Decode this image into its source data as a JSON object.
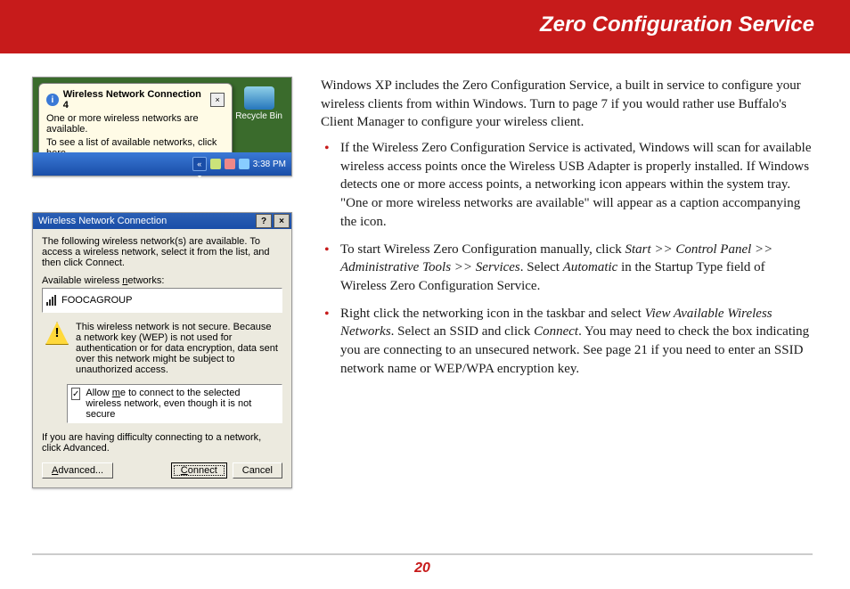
{
  "header": {
    "title": "Zero Configuration Service"
  },
  "footer": {
    "page_number": "20"
  },
  "intro": "Windows XP includes the Zero Configuration Service, a built in service to configure your wireless clients from within Windows.  Turn to page 7 if you would rather use Buffalo's Client Manager to configure your wireless client.",
  "bullets": {
    "b1": "If the Wireless Zero Configuration Service is activated, Windows will scan for available wireless access points once the Wireless USB Adapter is properly installed.  If Windows detects one or more access points, a networking icon appears within the system tray.  \"One or more wireless networks are available\" will appear as a caption accompanying the icon.",
    "b2_a": "To start Wireless Zero Configuration manually, click ",
    "b2_path": "Start >> Control Panel >> Administrative Tools >> Services",
    "b2_b": ". Select ",
    "b2_auto": "Automatic",
    "b2_c": " in the Startup Type field of Wireless Zero Configuration Service.",
    "b3_a": "Right click the networking icon in the taskbar and select ",
    "b3_view": "View Available Wireless Networks",
    "b3_b": ".  Select an SSID and click ",
    "b3_connect": "Connect",
    "b3_c": ".  You may need to check the box indicating you are connecting to an unsecured network.  See page 21 if you need to enter an SSID network name or WEP/WPA encryption key."
  },
  "shot1": {
    "balloon_title": "Wireless Network Connection 4",
    "balloon_line1": "One or more wireless networks are available.",
    "balloon_line2": "To see a list of available networks, click here.",
    "recycle_label": "Recycle Bin",
    "clock": "3:38 PM",
    "chevron": "«"
  },
  "shot2": {
    "title": "Wireless Network Connection",
    "help_btn": "?",
    "close_btn": "×",
    "intro": "The following wireless network(s) are available. To access a wireless network, select it from the list, and then click Connect.",
    "list_label_pre": "Available wireless ",
    "list_label_underline": "n",
    "list_label_post": "etworks:",
    "ssid": "FOOCAGROUP",
    "warning": "This wireless network is not secure. Because a network key (WEP) is not used for authentication or for data encryption, data sent over this network might be subject to unauthorized access.",
    "checkbox_pre": "Allow ",
    "checkbox_underline": "m",
    "checkbox_post": "e to connect to the selected wireless network, even though it is not secure",
    "checkbox_checked": "✓",
    "advice": "If you are having difficulty connecting to a network, click Advanced.",
    "advanced_u": "A",
    "advanced_rest": "dvanced...",
    "connect_u": "C",
    "connect_rest": "onnect",
    "cancel": "Cancel"
  }
}
